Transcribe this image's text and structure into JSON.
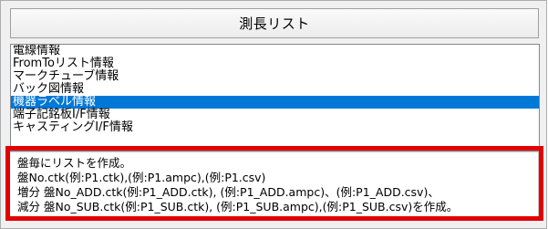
{
  "window": {
    "title": "測長リスト"
  },
  "list": {
    "items": [
      {
        "label": "電線情報",
        "selected": false
      },
      {
        "label": "FromToリスト情報",
        "selected": false
      },
      {
        "label": "マークチューブ情報",
        "selected": false
      },
      {
        "label": "バック図情報",
        "selected": false
      },
      {
        "label": "機器ラベル情報",
        "selected": true
      },
      {
        "label": "端子記銘板I/F情報",
        "selected": false
      },
      {
        "label": "キャスティングI/F情報",
        "selected": false
      }
    ]
  },
  "description": {
    "lines": [
      "盤毎にリストを作成。",
      "盤No.ctk(例:P1.ctk),(例:P1.ampc),(例:P1.csv)",
      "増分 盤No_ADD.ctk(例:P1_ADD.ctk), (例:P1_ADD.ampc)、(例:P1_ADD.csv)、",
      "減分 盤No_SUB.ctk(例:P1_SUB.ctk), (例:P1_SUB.ampc),(例:P1_SUB.csv)を作成。"
    ]
  },
  "colors": {
    "selection": "#0078d7",
    "highlight_border": "#e30000"
  }
}
